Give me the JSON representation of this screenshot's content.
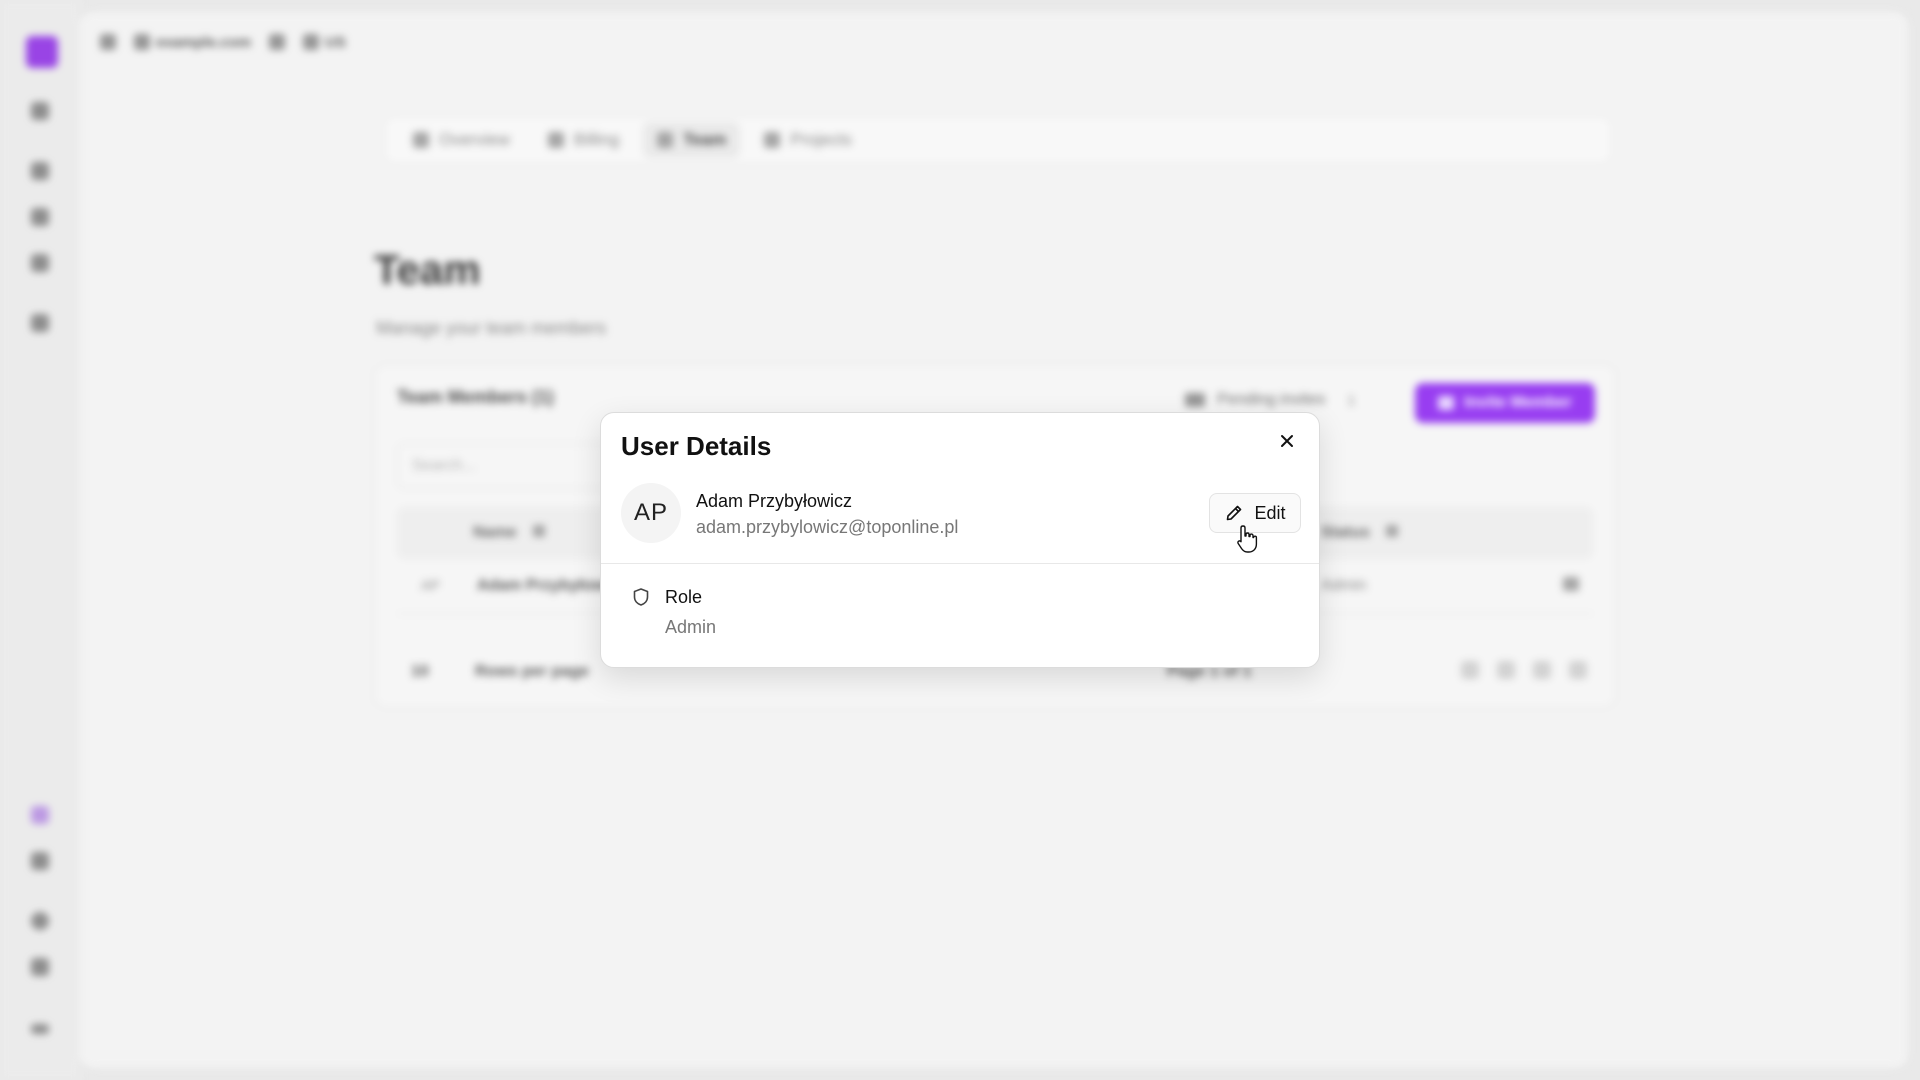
{
  "background": {
    "topbar": {
      "domain": "example.com",
      "locale": "US"
    },
    "tabs": [
      {
        "label": "Overview",
        "active": false
      },
      {
        "label": "Billing",
        "active": false
      },
      {
        "label": "Team",
        "active": true
      },
      {
        "label": "Projects",
        "active": false
      }
    ],
    "page": {
      "title": "Team",
      "subtitle": "Manage your team members"
    },
    "card": {
      "title": "Team Members (1)",
      "pending_label": "Pending invites",
      "pending_count": "1",
      "invite_button": "Invite Member",
      "search_placeholder": "Search...",
      "columns": {
        "name": "Name",
        "status": "Status"
      },
      "row": {
        "avatar": "AP",
        "name": "Adam Przybyłowicz",
        "status": "Admin"
      },
      "rows_per_page_value": "10",
      "rows_per_page_label": "Rows per page",
      "page_info": "Page 1 of 1"
    }
  },
  "modal": {
    "title": "User Details",
    "user": {
      "initials": "AP",
      "name": "Adam Przybyłowicz",
      "email": "adam.przybylowicz@toponline.pl"
    },
    "edit_label": "Edit",
    "role_label": "Role",
    "role_value": "Admin"
  },
  "icons": {
    "close": "close-icon",
    "edit": "pencil-icon",
    "role": "shield-icon",
    "cursor": "hand-pointer-icon"
  },
  "colors": {
    "accent": "#8a23f0"
  }
}
